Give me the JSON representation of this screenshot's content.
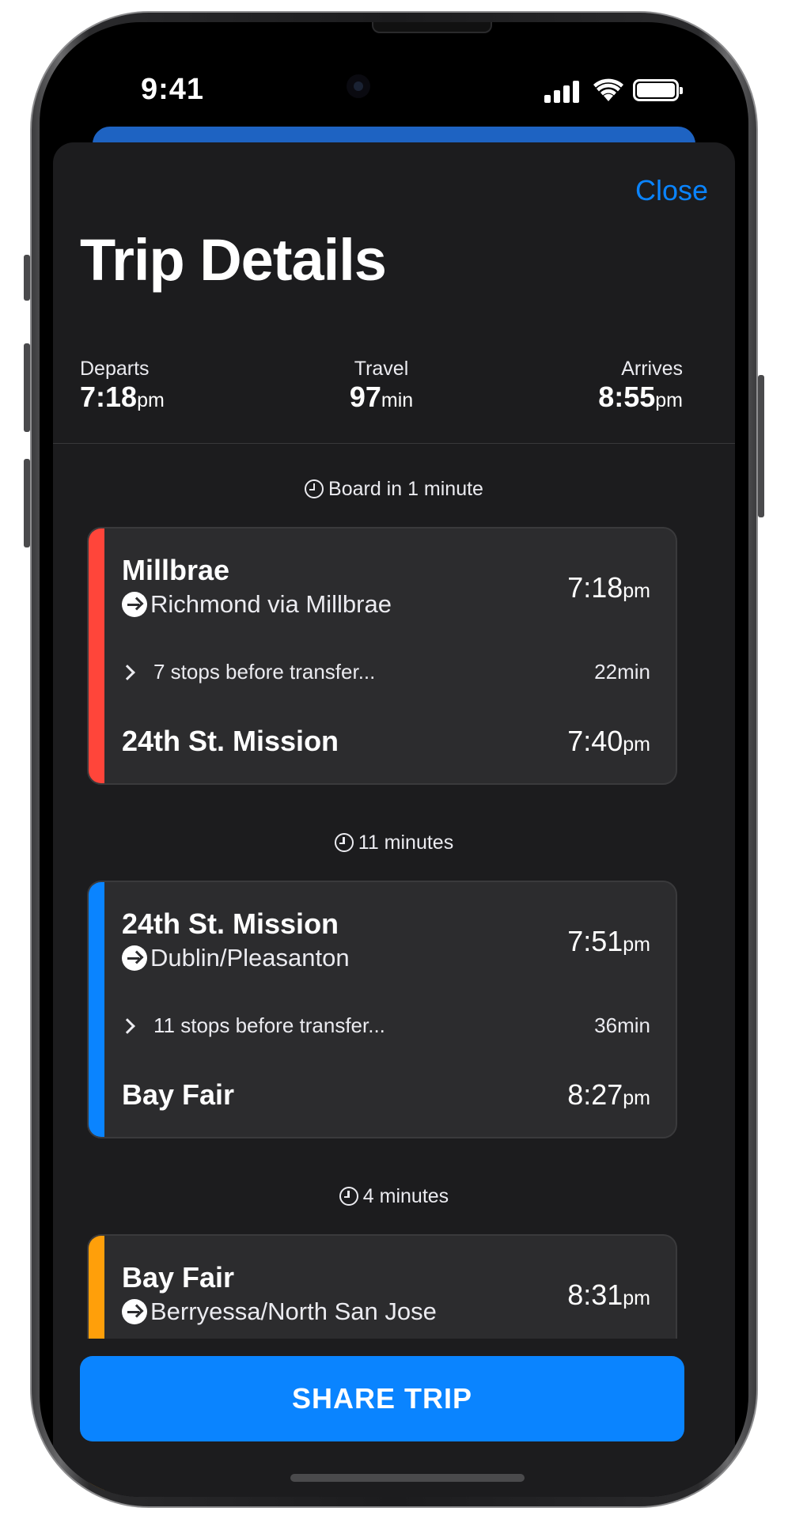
{
  "status_bar": {
    "time": "9:41"
  },
  "header": {
    "close_label": "Close",
    "title": "Trip Details"
  },
  "summary": {
    "departs": {
      "label": "Departs",
      "value": "7:18",
      "unit": "pm"
    },
    "travel": {
      "label": "Travel",
      "value": "97",
      "unit": "min"
    },
    "arrives": {
      "label": "Arrives",
      "value": "8:55",
      "unit": "pm"
    }
  },
  "waits": [
    "Board in 1 minute",
    "11 minutes",
    "4 minutes"
  ],
  "legs": [
    {
      "color": "#ff453a",
      "from": "Millbrae",
      "direction": "Richmond via Millbrae",
      "depart_time": "7:18",
      "depart_unit": "pm",
      "stops": "7 stops before transfer...",
      "duration": "22min",
      "to": "24th St. Mission",
      "arrive_time": "7:40",
      "arrive_unit": "pm"
    },
    {
      "color": "#0a84ff",
      "from": "24th St. Mission",
      "direction": "Dublin/Pleasanton",
      "depart_time": "7:51",
      "depart_unit": "pm",
      "stops": "11 stops before transfer...",
      "duration": "36min",
      "to": "Bay Fair",
      "arrive_time": "8:27",
      "arrive_unit": "pm"
    },
    {
      "color": "#ff9f0a",
      "from": "Bay Fair",
      "direction": "Berryessa/North San Jose",
      "depart_time": "8:31",
      "depart_unit": "pm"
    }
  ],
  "share_label": "SHARE TRIP",
  "colors": {
    "accent": "#0a84ff",
    "background": "#1c1c1e",
    "card": "#2c2c2e"
  }
}
